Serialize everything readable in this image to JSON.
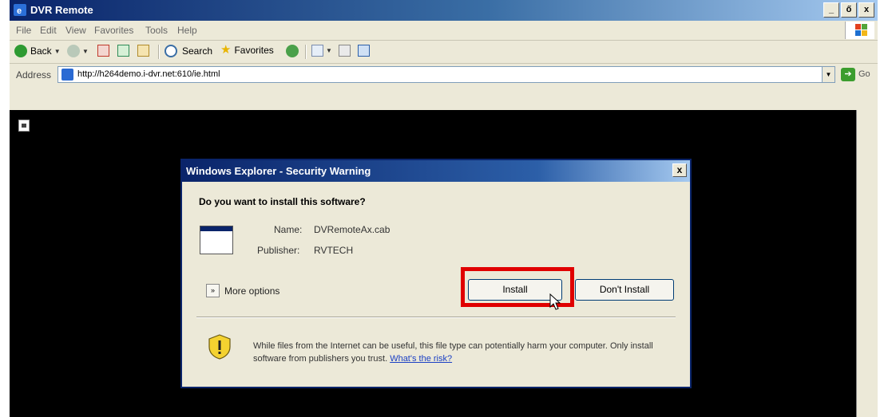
{
  "window": {
    "title": "DVR Remote",
    "controls": {
      "minimize": "_",
      "restore": "ő",
      "close": "x"
    }
  },
  "menu": [
    "File",
    "Edit",
    "View",
    "Favorites",
    "Tools",
    "Help"
  ],
  "toolbar": {
    "back": "Back",
    "search": "Search",
    "favorites": "Favorites"
  },
  "address": {
    "label": "Address",
    "url": "http://h264demo.i-dvr.net:610/ie.html",
    "go": "Go"
  },
  "dialog": {
    "title": "Windows Explorer - Security Warning",
    "close": "x",
    "question": "Do you want to install this software?",
    "name_label": "Name:",
    "name_value": "DVRemoteAx.cab",
    "publisher_label": "Publisher:",
    "publisher_value": "RVTECH",
    "more_options": "More options",
    "more_chevron": "»",
    "install_button": "Install",
    "dont_install_button": "Don't Install",
    "warning_text": "While files from the Internet can be useful, this file type can potentially harm your computer. Only install software from publishers you trust.",
    "risk_link": "What's the risk?"
  },
  "colors": {
    "title_bar": "#0a246a",
    "highlight_box": "#e00000",
    "content_background": "#000000",
    "window_face": "#ece9d8"
  },
  "icons": [
    "ie-icon",
    "windows-flag-icon",
    "back-icon",
    "forward-icon",
    "stop-icon",
    "refresh-icon",
    "home-icon",
    "search-icon",
    "favorites-star-icon",
    "history-icon",
    "mail-icon",
    "print-icon",
    "edit-icon",
    "page-icon",
    "go-arrow-icon",
    "broken-image-icon",
    "software-icon",
    "shield-warning-icon",
    "mouse-cursor-icon"
  ]
}
